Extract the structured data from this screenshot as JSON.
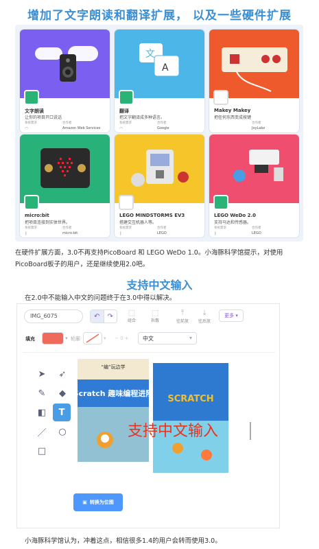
{
  "headline": "增加了文字朗读和翻译扩展， 以及一些硬件扩展",
  "cards": [
    {
      "title": "文字朗读",
      "desc": "让你的项目开口说话",
      "req_label": "系统需求",
      "col_label": "合作者",
      "collaborator": "Amazon Web Services",
      "req_icon": "wifi-icon",
      "banner": "#7a5ff0"
    },
    {
      "title": "翻译",
      "desc": "把文字翻译成多种语言。",
      "req_label": "系统需求",
      "col_label": "合作者",
      "collaborator": "Google",
      "req_icon": "wifi-icon",
      "banner": "#4cb6e8"
    },
    {
      "title": "Makey Makey",
      "desc": "把任何东西变成按键",
      "req_label": "",
      "col_label": "合作者",
      "collaborator": "JoyLabz",
      "req_icon": "",
      "banner": "#ee5a2c"
    },
    {
      "title": "micro:bit",
      "desc": "把项目连接到实体世界。",
      "req_label": "系统需求",
      "col_label": "合作者",
      "collaborator": "micro:bit",
      "req_icon": "bluetooth-icon",
      "banner": "#28b27a"
    },
    {
      "title": "LEGO MINDSTORMS EV3",
      "desc": "搭建交互机器人等。",
      "req_label": "系统需求",
      "col_label": "合作者",
      "collaborator": "LEGO",
      "req_icon": "bluetooth-icon",
      "banner": "#f5c52a"
    },
    {
      "title": "LEGO WeDo 2.0",
      "desc": "支持马达和传感器。",
      "req_label": "系统需求",
      "col_label": "合作者",
      "collaborator": "LEGO",
      "req_icon": "bluetooth-icon",
      "banner": "#f04e6e"
    }
  ],
  "para1": "在硬件扩展方面，3.0不再支持PicoBoard 和 LEGO WeDo 1.0。小海豚科学馆提示，对使用PicoBoard板子的用户，还是继续使用2.0吧。",
  "headline2": "支持中文输入",
  "para2": "在2.0中不能输入中文的问题终于在3.0中得以解决。",
  "editor": {
    "costume_name": "IMG_6075",
    "group_label": "组合",
    "ungroup_label": "拆散",
    "forward_label": "往前放",
    "backward_label": "往后放",
    "more_label": "更多",
    "fill_label": "填充",
    "outline_label": "轮廓",
    "outline_width": "0",
    "font_value": "中文",
    "canvas_text": "支持中文输入",
    "book1_title": "Scratch 趣味编程进阶",
    "book1_top": "“编”玩边学",
    "book2_title": "SCRATCH",
    "convert_label": "转换为位图",
    "fill_color": "#ee6a5a",
    "canvas_text_color": "#e8331f"
  },
  "para3": "小海豚科学馆认为，冲着这点，相信很多1.4的用户会转而使用3.0。"
}
